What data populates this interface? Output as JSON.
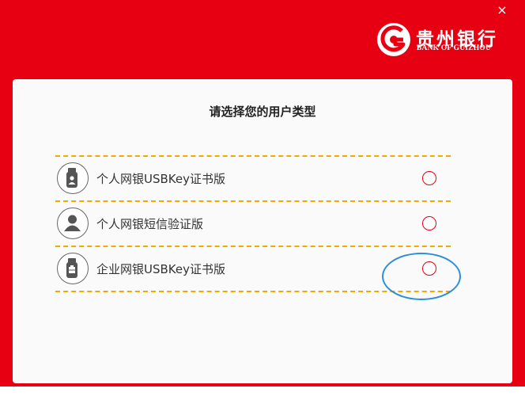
{
  "header": {
    "bank_name_cn": "贵州银行",
    "bank_name_en": "BANK OF GUIZHOU",
    "close_glyph": "×",
    "brand_color": "#e60012"
  },
  "dialog": {
    "title": "请选择您的用户类型",
    "options": [
      {
        "label": "个人网银USBKey证书版",
        "icon": "usbkey-person-icon",
        "selected": false
      },
      {
        "label": "个人网银短信验证版",
        "icon": "user-avatar-icon",
        "selected": false
      },
      {
        "label": "企业网银USBKey证书版",
        "icon": "usbkey-enterprise-icon",
        "selected": false
      }
    ]
  },
  "colors": {
    "divider": "#f2a900",
    "radio_border": "#e60012",
    "annotation": "#2d8fdc"
  }
}
